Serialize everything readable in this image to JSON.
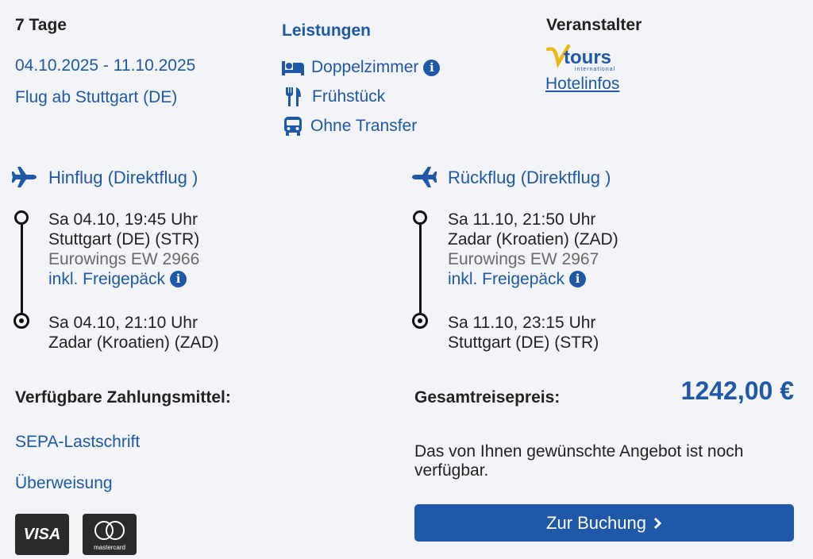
{
  "trip": {
    "duration": "7 Tage",
    "dates": "04.10.2025 - 11.10.2025",
    "departure": "Flug ab Stuttgart (DE)"
  },
  "services": {
    "heading": "Leistungen",
    "items": [
      {
        "icon": "bed-icon",
        "label": "Doppelzimmer"
      },
      {
        "icon": "cutlery-icon",
        "label": "Frühstück"
      },
      {
        "icon": "bus-icon",
        "label": "Ohne Transfer"
      }
    ]
  },
  "operator": {
    "heading": "Veranstalter",
    "logo_text": "Vtours",
    "logo_sub": "international",
    "hotel_link": "Hotelinfos"
  },
  "outbound": {
    "title": "Hinflug (Direktflug )",
    "dep_time": "Sa 04.10, 19:45 Uhr",
    "dep_airport": "Stuttgart (DE) (STR)",
    "carrier": "Eurowings EW 2966",
    "baggage": "inkl. Freigepäck",
    "arr_time": "Sa 04.10, 21:10 Uhr",
    "arr_airport": "Zadar (Kroatien) (ZAD)"
  },
  "inbound": {
    "title": "Rückflug (Direktflug )",
    "dep_time": "Sa 11.10, 21:50 Uhr",
    "dep_airport": "Zadar (Kroatien) (ZAD)",
    "carrier": "Eurowings EW 2967",
    "baggage": "inkl. Freigepäck",
    "arr_time": "Sa 11.10, 23:15 Uhr",
    "arr_airport": "Stuttgart (DE) (STR)"
  },
  "payment": {
    "heading": "Verfügbare Zahlungsmittel:",
    "methods": [
      "SEPA-Lastschrift",
      "Überweisung"
    ],
    "visa_label": "VISA",
    "mastercard_label": "mastercard"
  },
  "price": {
    "label": "Gesamtreisepreis:",
    "value": "1242,00 €",
    "availability": "Das von Ihnen gewünschte Angebot ist noch verfügbar.",
    "button": "Zur Buchung"
  },
  "colors": {
    "accent": "#1f58a8",
    "background": "#f2f4f7"
  }
}
